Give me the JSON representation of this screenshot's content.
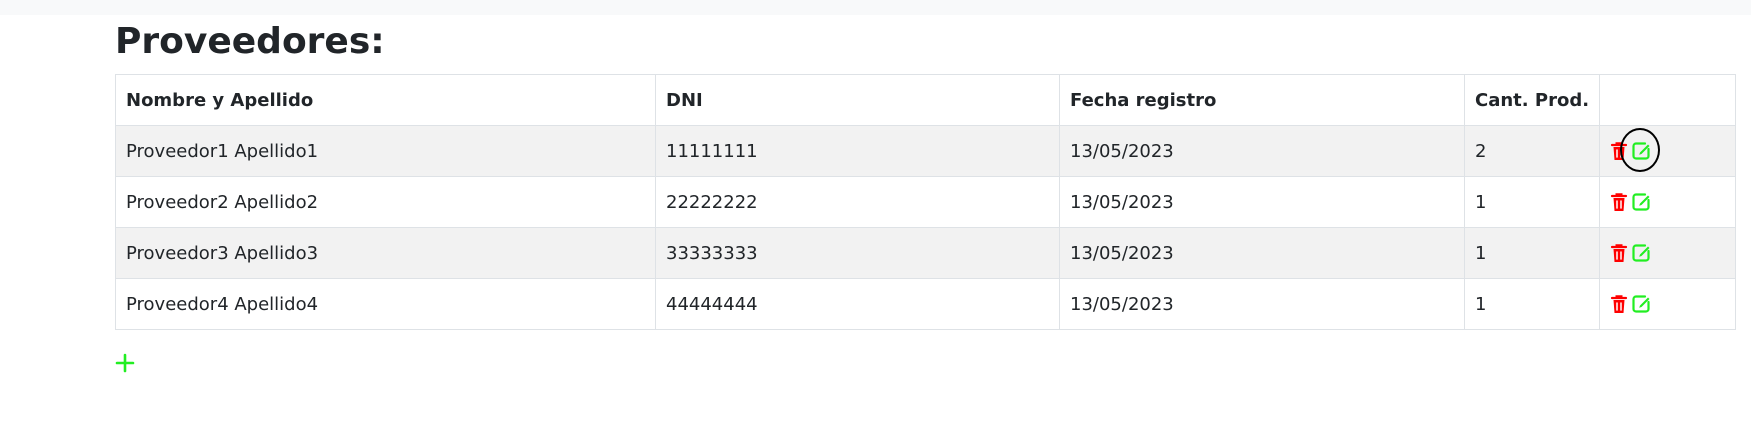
{
  "page": {
    "title": "Proveedores:"
  },
  "colors": {
    "delete": "#ff0000",
    "edit": "#22ee22",
    "add": "#22ee22",
    "highlight": "#000000"
  },
  "table": {
    "headers": {
      "name": "Nombre y Apellido",
      "dni": "DNI",
      "date": "Fecha registro",
      "qty": "Cant. Prod.",
      "actions": ""
    },
    "rows": [
      {
        "name": "Proveedor1 Apellido1",
        "dni": "11111111",
        "date": "13/05/2023",
        "qty": "2"
      },
      {
        "name": "Proveedor2 Apellido2",
        "dni": "22222222",
        "date": "13/05/2023",
        "qty": "1"
      },
      {
        "name": "Proveedor3 Apellido3",
        "dni": "33333333",
        "date": "13/05/2023",
        "qty": "1"
      },
      {
        "name": "Proveedor4 Apellido4",
        "dni": "44444444",
        "date": "13/05/2023",
        "qty": "1"
      }
    ],
    "row_actions": {
      "delete_icon": "trash-icon",
      "edit_icon": "edit-icon"
    },
    "highlighted_action": {
      "row": 0,
      "action": "edit"
    }
  },
  "add_button": {
    "icon": "plus-icon"
  }
}
